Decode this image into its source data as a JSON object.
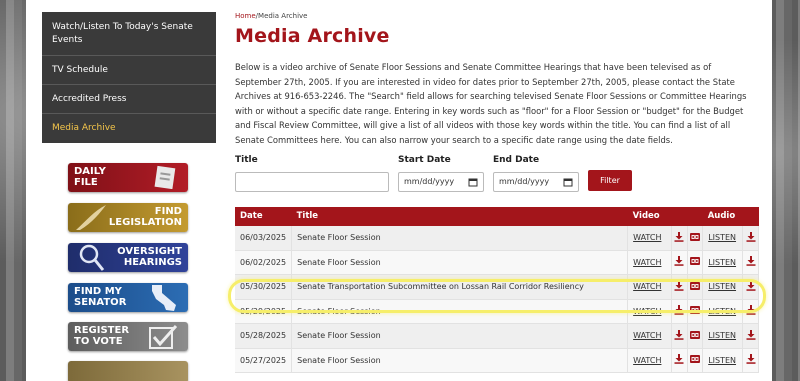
{
  "sidebar": {
    "items": [
      {
        "label": "Watch/Listen To Today's Senate Events"
      },
      {
        "label": "TV Schedule"
      },
      {
        "label": "Accredited Press"
      },
      {
        "label": "Media Archive"
      }
    ],
    "promos": [
      {
        "line1": "Daily",
        "line2": "File",
        "color": "#a3151b"
      },
      {
        "line1": "Find",
        "line2": "Legislation",
        "color": "#b38c2a"
      },
      {
        "line1": "Oversight",
        "line2": "Hearings",
        "color": "#2a3a8a"
      },
      {
        "line1": "Find My",
        "line2": "Senator",
        "color": "#2a63a8"
      },
      {
        "line1": "Register",
        "line2": "To Vote",
        "color": "#777777"
      }
    ]
  },
  "breadcrumb": {
    "home": "Home",
    "sep": "/",
    "current": "Media Archive"
  },
  "page_title": "Media Archive",
  "intro": "Below is a video archive of Senate Floor Sessions and Senate Committee Hearings that have been televised as of September 27th, 2005. If you are interested in video for dates prior to September 27th, 2005, please contact the State Archives at 916-653-2246. The \"Search\" field allows for searching televised Senate Floor Sessions or Committee Hearings with or without a specific date range. Entering in key words such as \"floor\" for a Floor Session or \"budget\" for the Budget and Fiscal Review Committee, will give a list of all videos with those key words within the title. You can find a list of all Senate Committees here. You can also narrow your search to a specific date range using the date fields.",
  "filters": {
    "title_label": "Title",
    "title_value": "",
    "start_label": "Start Date",
    "start_placeholder": "mm/dd/yyyy",
    "end_label": "End Date",
    "end_placeholder": "mm/dd/yyyy",
    "button": "Filter"
  },
  "table": {
    "headers": {
      "date": "Date",
      "title": "Title",
      "video": "Video",
      "audio": "Audio"
    },
    "watch_label": "WATCH",
    "listen_label": "LISTEN",
    "rows": [
      {
        "date": "06/03/2025",
        "title": "Senate Floor Session"
      },
      {
        "date": "06/02/2025",
        "title": "Senate Floor Session"
      },
      {
        "date": "05/30/2025",
        "title": "Senate Transportation Subcommittee on Lossan Rail Corridor Resiliency"
      },
      {
        "date": "05/29/2025",
        "title": "Senate Floor Session"
      },
      {
        "date": "05/28/2025",
        "title": "Senate Floor Session"
      },
      {
        "date": "05/27/2025",
        "title": "Senate Floor Session"
      }
    ]
  },
  "colors": {
    "brand": "#a3151b",
    "highlight": "#f6ee6a",
    "active_nav": "#f4c54a"
  }
}
